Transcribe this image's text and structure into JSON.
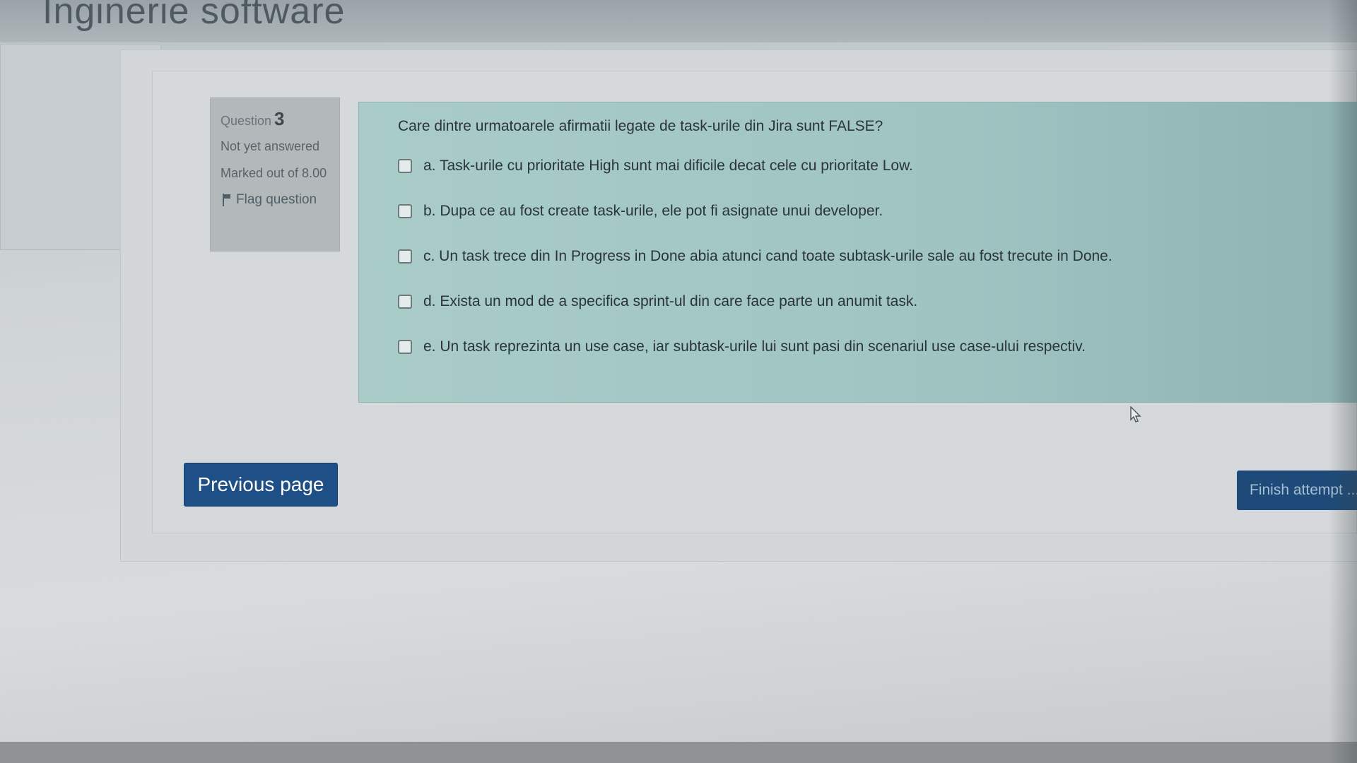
{
  "header": {
    "title": "Inginerie software"
  },
  "question": {
    "label": "Question",
    "number": "3",
    "state": "Not yet answered",
    "marked": "Marked out of 8.00",
    "flag_label": "Flag question",
    "text": "Care dintre urmatoarele afirmatii legate de task-urile din Jira sunt FALSE?",
    "answers": [
      {
        "label": "a. Task-urile cu prioritate High sunt mai dificile decat cele cu prioritate Low.",
        "checked": false
      },
      {
        "label": "b. Dupa ce au fost create task-urile, ele pot fi asignate unui developer.",
        "checked": false
      },
      {
        "label": "c. Un task trece din In Progress in Done abia atunci cand toate subtask-urile sale au fost trecute in Done.",
        "checked": false
      },
      {
        "label": "d. Exista un mod de a specifica sprint-ul din care face parte un anumit task.",
        "checked": false
      },
      {
        "label": "e. Un task reprezinta un use case, iar subtask-urile lui sunt pasi din scenariul use case-ului respectiv.",
        "checked": false
      }
    ]
  },
  "navigation": {
    "previous_label": "Previous page",
    "finish_label": "Finish attempt ..."
  },
  "colors": {
    "primary_button": "#1e4f86",
    "question_background": "#a9ccc9",
    "info_background": "#b3b8bb"
  }
}
